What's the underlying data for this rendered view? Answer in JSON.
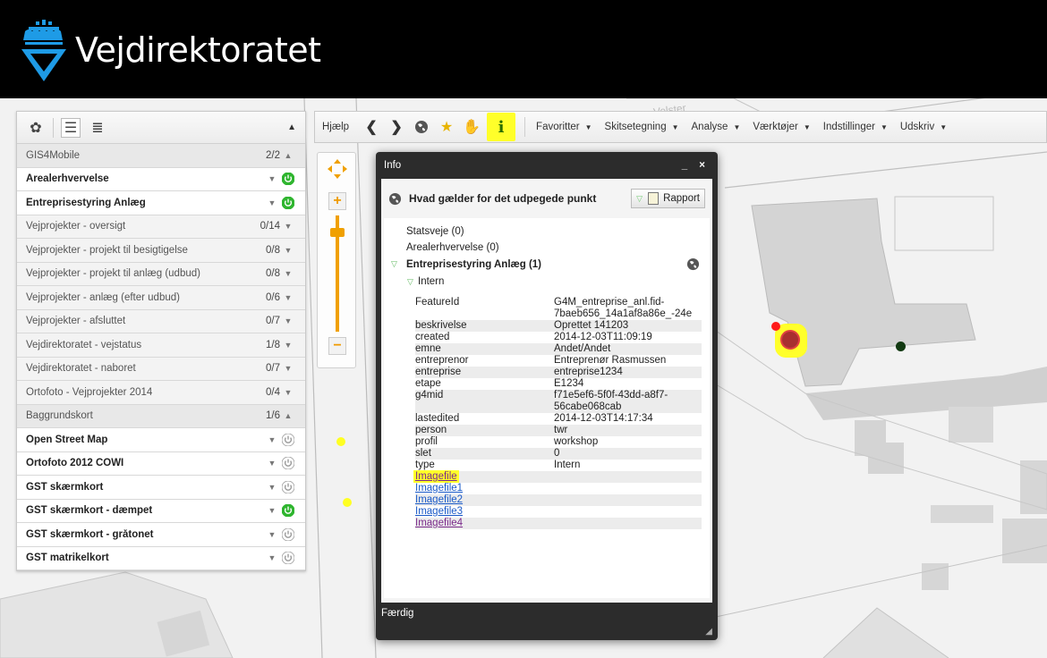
{
  "header": {
    "brand": "Vejdirektoratet"
  },
  "colors": {
    "accent": "#ffff2a",
    "power_on": "#2fb52f",
    "power_off": "#9a9a9a",
    "header_bg": "#000000"
  },
  "layer_panel": {
    "toolbar_icons": [
      "gear-icon",
      "list-icon",
      "list-detail-icon"
    ],
    "collapse": "▲",
    "rows": [
      {
        "label": "GIS4Mobile",
        "count": "2/2",
        "type": "grp",
        "chev": "▲"
      },
      {
        "label": "Arealerhvervelse",
        "count": "",
        "type": "on",
        "chev": "▼",
        "power": "on"
      },
      {
        "label": "Entreprisestyring Anlæg",
        "count": "",
        "type": "on",
        "chev": "▼",
        "power": "on"
      },
      {
        "label": "Vejprojekter - oversigt",
        "count": "0/14",
        "type": "sub",
        "chev": "▼"
      },
      {
        "label": "Vejprojekter - projekt til besigtigelse",
        "count": "0/8",
        "type": "sub",
        "chev": "▼"
      },
      {
        "label": "Vejprojekter - projekt til anlæg (udbud)",
        "count": "0/8",
        "type": "sub",
        "chev": "▼"
      },
      {
        "label": "Vejprojekter - anlæg (efter udbud)",
        "count": "0/6",
        "type": "sub",
        "chev": "▼"
      },
      {
        "label": "Vejprojekter - afsluttet",
        "count": "0/7",
        "type": "sub",
        "chev": "▼"
      },
      {
        "label": "Vejdirektoratet - vejstatus",
        "count": "1/8",
        "type": "sub",
        "chev": "▼"
      },
      {
        "label": "Vejdirektoratet - naboret",
        "count": "0/7",
        "type": "sub",
        "chev": "▼"
      },
      {
        "label": "Ortofoto - Vejprojekter 2014",
        "count": "0/4",
        "type": "sub",
        "chev": "▼"
      },
      {
        "label": "Baggrundskort",
        "count": "1/6",
        "type": "grp",
        "chev": "▲"
      },
      {
        "label": "Open Street Map",
        "count": "",
        "type": "on",
        "chev": "▼",
        "power": "off"
      },
      {
        "label": "Ortofoto 2012 COWI",
        "count": "",
        "type": "on",
        "chev": "▼",
        "power": "off"
      },
      {
        "label": "GST skærmkort",
        "count": "",
        "type": "on",
        "chev": "▼",
        "power": "off"
      },
      {
        "label": "GST skærmkort - dæmpet",
        "count": "",
        "type": "on",
        "chev": "▼",
        "power": "on"
      },
      {
        "label": "GST skærmkort - gråtonet",
        "count": "",
        "type": "on",
        "chev": "▼",
        "power": "off"
      },
      {
        "label": "GST matrikelkort",
        "count": "",
        "type": "on",
        "chev": "▼",
        "power": "off"
      }
    ]
  },
  "toolbar": {
    "help": "Hjælp",
    "icons": [
      "back-icon",
      "forward-icon",
      "globe-icon",
      "star-icon",
      "hand-icon",
      "info-icon"
    ],
    "info_label": "i",
    "menus": [
      "Favoritter",
      "Skitsetegning",
      "Analyse",
      "Værktøjer",
      "Indstillinger",
      "Udskriv"
    ]
  },
  "zoom": {
    "plus": "+",
    "minus": "−"
  },
  "info_dialog": {
    "title": "Info",
    "controls": "_ ×",
    "heading": "Hvad gælder for det udpegede punkt",
    "rapport": "Rapport",
    "sections": {
      "statsveje": "Statsveje (0)",
      "arealerhvervelse": "Arealerhvervelse (0)",
      "entreprisestyring": "Entreprisestyring Anlæg (1)",
      "intern": "Intern"
    },
    "attributes": [
      {
        "key": "FeatureId",
        "value": "G4M_entreprise_anl.fid-7baeb656_14a1af8a86e_-24e"
      },
      {
        "key": "beskrivelse",
        "value": "Oprettet 141203"
      },
      {
        "key": "created",
        "value": "2014-12-03T11:09:19"
      },
      {
        "key": "emne",
        "value": "Andet/Andet"
      },
      {
        "key": "entreprenor",
        "value": "Entreprenør Rasmussen"
      },
      {
        "key": "entreprise",
        "value": "entreprise1234"
      },
      {
        "key": "etape",
        "value": "E1234"
      },
      {
        "key": "g4mid",
        "value": "f71e5ef6-5f0f-43dd-a8f7-56cabe068cab"
      },
      {
        "key": "lastedited",
        "value": "2014-12-03T14:17:34"
      },
      {
        "key": "person",
        "value": "twr"
      },
      {
        "key": "profil",
        "value": "workshop"
      },
      {
        "key": "slet",
        "value": "0"
      },
      {
        "key": "type",
        "value": "Intern"
      }
    ],
    "links": [
      "Imagefile",
      "Imagefile1",
      "Imagefile2",
      "Imagefile3",
      "Imagefile4"
    ],
    "footer": "Færdig"
  },
  "map": {
    "street_label": "Velster"
  }
}
